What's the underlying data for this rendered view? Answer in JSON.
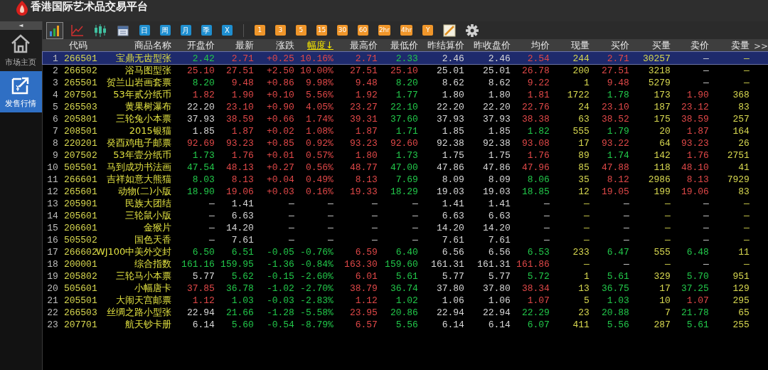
{
  "window": {
    "title": "香港国际艺术品交易平台"
  },
  "sidebar": {
    "collapse": "◄",
    "items": [
      {
        "label": "市场主页",
        "kind": "home",
        "selected": false
      },
      {
        "label": "发售行情",
        "kind": "trade",
        "selected": true
      }
    ]
  },
  "toolbar": {
    "chart_types": [
      {
        "kind": "bars",
        "selected": true
      },
      {
        "kind": "line",
        "selected": false
      },
      {
        "kind": "candles",
        "selected": false
      },
      {
        "kind": "calendar",
        "selected": false
      }
    ],
    "day_periods": [
      "日",
      "周",
      "月",
      "季",
      "X"
    ],
    "minute_periods": [
      "1",
      "3",
      "5",
      "15",
      "30",
      "60",
      "2hr",
      "4hr",
      "Y"
    ],
    "tools": [
      {
        "kind": "ruler"
      },
      {
        "kind": "gear"
      }
    ]
  },
  "table": {
    "columns": [
      {
        "label": "代码",
        "sorted": false
      },
      {
        "label": "商品名称",
        "sorted": false
      },
      {
        "label": "开盘价",
        "sorted": false
      },
      {
        "label": "最新",
        "sorted": false
      },
      {
        "label": "涨跌",
        "sorted": false
      },
      {
        "label": "幅度↓",
        "sorted": true
      },
      {
        "label": "最高价",
        "sorted": false
      },
      {
        "label": "最低价",
        "sorted": false
      },
      {
        "label": "昨结算价",
        "sorted": false
      },
      {
        "label": "昨收盘价",
        "sorted": false
      },
      {
        "label": "均价",
        "sorted": false
      },
      {
        "label": "现量",
        "sorted": false
      },
      {
        "label": "买价",
        "sorted": false
      },
      {
        "label": "买量",
        "sorted": false
      },
      {
        "label": "卖价",
        "sorted": false
      },
      {
        "label": "卖量",
        "sorted": false
      }
    ],
    "more": ">>",
    "rows": [
      {
        "no": "1",
        "selected": true,
        "cells": [
          {
            "text": "266501"
          },
          {
            "text": "宝鼎无齿型张"
          },
          {
            "text": "2.42",
            "color": "#22c84a"
          },
          {
            "text": "2.71",
            "color": "#e04848"
          },
          {
            "text": "+0.25",
            "color": "#e04848"
          },
          {
            "text": "10.16%",
            "color": "#e04848"
          },
          {
            "text": "2.71",
            "color": "#e04848"
          },
          {
            "text": "2.33",
            "color": "#22c84a"
          },
          {
            "text": "2.46",
            "color": "#d8d8d8"
          },
          {
            "text": "2.46",
            "color": "#d8d8d8"
          },
          {
            "text": "2.54",
            "color": "#e04848"
          },
          {
            "text": "244",
            "color": "#d8d850"
          },
          {
            "text": "2.71",
            "color": "#e04848"
          },
          {
            "text": "30257",
            "color": "#d8d850"
          },
          {
            "text": "—"
          },
          {
            "text": "—"
          }
        ]
      },
      {
        "no": "2",
        "selected": false,
        "cells": [
          {
            "text": "266502"
          },
          {
            "text": "浴马图型张"
          },
          {
            "text": "25.10",
            "color": "#e04848"
          },
          {
            "text": "27.51",
            "color": "#e04848"
          },
          {
            "text": "+2.50",
            "color": "#e04848"
          },
          {
            "text": "10.00%",
            "color": "#e04848"
          },
          {
            "text": "27.51",
            "color": "#e04848"
          },
          {
            "text": "25.10",
            "color": "#e04848"
          },
          {
            "text": "25.01",
            "color": "#d8d8d8"
          },
          {
            "text": "25.01",
            "color": "#d8d8d8"
          },
          {
            "text": "26.78",
            "color": "#e04848"
          },
          {
            "text": "200",
            "color": "#d8d850"
          },
          {
            "text": "27.51",
            "color": "#e04848"
          },
          {
            "text": "3218",
            "color": "#d8d850"
          },
          {
            "text": "—"
          },
          {
            "text": "—"
          }
        ]
      },
      {
        "no": "3",
        "selected": false,
        "cells": [
          {
            "text": "265501"
          },
          {
            "text": "贺兰山岩画套票"
          },
          {
            "text": "8.20",
            "color": "#22c84a"
          },
          {
            "text": "9.48",
            "color": "#e04848"
          },
          {
            "text": "+0.86",
            "color": "#e04848"
          },
          {
            "text": "9.98%",
            "color": "#e04848"
          },
          {
            "text": "9.48",
            "color": "#e04848"
          },
          {
            "text": "8.20",
            "color": "#22c84a"
          },
          {
            "text": "8.62",
            "color": "#d8d8d8"
          },
          {
            "text": "8.62",
            "color": "#d8d8d8"
          },
          {
            "text": "9.22",
            "color": "#e04848"
          },
          {
            "text": "1",
            "color": "#d8d850"
          },
          {
            "text": "9.48",
            "color": "#e04848"
          },
          {
            "text": "5279",
            "color": "#d8d850"
          },
          {
            "text": "—"
          },
          {
            "text": "—"
          }
        ]
      },
      {
        "no": "4",
        "selected": false,
        "cells": [
          {
            "text": "207501"
          },
          {
            "text": "53年贰分纸币"
          },
          {
            "text": "1.82",
            "color": "#e04848"
          },
          {
            "text": "1.90",
            "color": "#e04848"
          },
          {
            "text": "+0.10",
            "color": "#e04848"
          },
          {
            "text": "5.56%",
            "color": "#e04848"
          },
          {
            "text": "1.92",
            "color": "#e04848"
          },
          {
            "text": "1.77",
            "color": "#22c84a"
          },
          {
            "text": "1.80",
            "color": "#d8d8d8"
          },
          {
            "text": "1.80",
            "color": "#d8d8d8"
          },
          {
            "text": "1.81",
            "color": "#e04848"
          },
          {
            "text": "1722",
            "color": "#d8d850"
          },
          {
            "text": "1.78",
            "color": "#22c84a"
          },
          {
            "text": "173",
            "color": "#d8d850"
          },
          {
            "text": "1.90",
            "color": "#e04848"
          },
          {
            "text": "368",
            "color": "#d8d850"
          }
        ]
      },
      {
        "no": "5",
        "selected": false,
        "cells": [
          {
            "text": "265503"
          },
          {
            "text": "黄果树瀑布"
          },
          {
            "text": "22.20",
            "color": "#d8d8d8"
          },
          {
            "text": "23.10",
            "color": "#e04848"
          },
          {
            "text": "+0.90",
            "color": "#e04848"
          },
          {
            "text": "4.05%",
            "color": "#e04848"
          },
          {
            "text": "23.27",
            "color": "#e04848"
          },
          {
            "text": "22.10",
            "color": "#22c84a"
          },
          {
            "text": "22.20",
            "color": "#d8d8d8"
          },
          {
            "text": "22.20",
            "color": "#d8d8d8"
          },
          {
            "text": "22.76",
            "color": "#e04848"
          },
          {
            "text": "24",
            "color": "#d8d850"
          },
          {
            "text": "23.10",
            "color": "#e04848"
          },
          {
            "text": "187",
            "color": "#d8d850"
          },
          {
            "text": "23.12",
            "color": "#e04848"
          },
          {
            "text": "83",
            "color": "#d8d850"
          }
        ]
      },
      {
        "no": "6",
        "selected": false,
        "cells": [
          {
            "text": "205801"
          },
          {
            "text": "三轮兔小本票"
          },
          {
            "text": "37.93",
            "color": "#d8d8d8"
          },
          {
            "text": "38.59",
            "color": "#e04848"
          },
          {
            "text": "+0.66",
            "color": "#e04848"
          },
          {
            "text": "1.74%",
            "color": "#e04848"
          },
          {
            "text": "39.31",
            "color": "#e04848"
          },
          {
            "text": "37.60",
            "color": "#22c84a"
          },
          {
            "text": "37.93",
            "color": "#d8d8d8"
          },
          {
            "text": "37.93",
            "color": "#d8d8d8"
          },
          {
            "text": "38.38",
            "color": "#e04848"
          },
          {
            "text": "63",
            "color": "#d8d850"
          },
          {
            "text": "38.52",
            "color": "#e04848"
          },
          {
            "text": "175",
            "color": "#d8d850"
          },
          {
            "text": "38.59",
            "color": "#e04848"
          },
          {
            "text": "257",
            "color": "#d8d850"
          }
        ]
      },
      {
        "no": "7",
        "selected": false,
        "cells": [
          {
            "text": "208501"
          },
          {
            "text": "2015银猫"
          },
          {
            "text": "1.85",
            "color": "#d8d8d8"
          },
          {
            "text": "1.87",
            "color": "#e04848"
          },
          {
            "text": "+0.02",
            "color": "#e04848"
          },
          {
            "text": "1.08%",
            "color": "#e04848"
          },
          {
            "text": "1.87",
            "color": "#e04848"
          },
          {
            "text": "1.71",
            "color": "#22c84a"
          },
          {
            "text": "1.85",
            "color": "#d8d8d8"
          },
          {
            "text": "1.85",
            "color": "#d8d8d8"
          },
          {
            "text": "1.82",
            "color": "#22c84a"
          },
          {
            "text": "555",
            "color": "#d8d850"
          },
          {
            "text": "1.79",
            "color": "#22c84a"
          },
          {
            "text": "20",
            "color": "#d8d850"
          },
          {
            "text": "1.87",
            "color": "#e04848"
          },
          {
            "text": "164",
            "color": "#d8d850"
          }
        ]
      },
      {
        "no": "8",
        "selected": false,
        "cells": [
          {
            "text": "220201"
          },
          {
            "text": "癸酉鸡电子邮票"
          },
          {
            "text": "92.69",
            "color": "#e04848"
          },
          {
            "text": "93.23",
            "color": "#e04848"
          },
          {
            "text": "+0.85",
            "color": "#e04848"
          },
          {
            "text": "0.92%",
            "color": "#e04848"
          },
          {
            "text": "93.23",
            "color": "#e04848"
          },
          {
            "text": "92.60",
            "color": "#e04848"
          },
          {
            "text": "92.38",
            "color": "#d8d8d8"
          },
          {
            "text": "92.38",
            "color": "#d8d8d8"
          },
          {
            "text": "93.08",
            "color": "#e04848"
          },
          {
            "text": "17",
            "color": "#d8d850"
          },
          {
            "text": "93.22",
            "color": "#e04848"
          },
          {
            "text": "64",
            "color": "#d8d850"
          },
          {
            "text": "93.23",
            "color": "#e04848"
          },
          {
            "text": "26",
            "color": "#d8d850"
          }
        ]
      },
      {
        "no": "9",
        "selected": false,
        "cells": [
          {
            "text": "207502"
          },
          {
            "text": "53年壹分纸币"
          },
          {
            "text": "1.73",
            "color": "#22c84a"
          },
          {
            "text": "1.76",
            "color": "#e04848"
          },
          {
            "text": "+0.01",
            "color": "#e04848"
          },
          {
            "text": "0.57%",
            "color": "#e04848"
          },
          {
            "text": "1.80",
            "color": "#e04848"
          },
          {
            "text": "1.73",
            "color": "#22c84a"
          },
          {
            "text": "1.75",
            "color": "#d8d8d8"
          },
          {
            "text": "1.75",
            "color": "#d8d8d8"
          },
          {
            "text": "1.76",
            "color": "#e04848"
          },
          {
            "text": "89",
            "color": "#d8d850"
          },
          {
            "text": "1.74",
            "color": "#22c84a"
          },
          {
            "text": "142",
            "color": "#d8d850"
          },
          {
            "text": "1.76",
            "color": "#e04848"
          },
          {
            "text": "2751",
            "color": "#d8d850"
          }
        ]
      },
      {
        "no": "10",
        "selected": false,
        "cells": [
          {
            "text": "505501"
          },
          {
            "text": "马到成功书法画"
          },
          {
            "text": "47.54",
            "color": "#22c84a"
          },
          {
            "text": "48.13",
            "color": "#e04848"
          },
          {
            "text": "+0.27",
            "color": "#e04848"
          },
          {
            "text": "0.56%",
            "color": "#e04848"
          },
          {
            "text": "48.77",
            "color": "#e04848"
          },
          {
            "text": "47.00",
            "color": "#22c84a"
          },
          {
            "text": "47.86",
            "color": "#d8d8d8"
          },
          {
            "text": "47.86",
            "color": "#d8d8d8"
          },
          {
            "text": "47.96",
            "color": "#e04848"
          },
          {
            "text": "85",
            "color": "#d8d850"
          },
          {
            "text": "47.88",
            "color": "#e04848"
          },
          {
            "text": "118",
            "color": "#d8d850"
          },
          {
            "text": "48.10",
            "color": "#e04848"
          },
          {
            "text": "41",
            "color": "#d8d850"
          }
        ]
      },
      {
        "no": "11",
        "selected": false,
        "cells": [
          {
            "text": "266601"
          },
          {
            "text": "吉祥如意大熊猫"
          },
          {
            "text": "8.03",
            "color": "#22c84a"
          },
          {
            "text": "8.13",
            "color": "#e04848"
          },
          {
            "text": "+0.04",
            "color": "#e04848"
          },
          {
            "text": "0.49%",
            "color": "#e04848"
          },
          {
            "text": "8.13",
            "color": "#e04848"
          },
          {
            "text": "7.69",
            "color": "#22c84a"
          },
          {
            "text": "8.09",
            "color": "#d8d8d8"
          },
          {
            "text": "8.09",
            "color": "#d8d8d8"
          },
          {
            "text": "8.06",
            "color": "#22c84a"
          },
          {
            "text": "35",
            "color": "#d8d850"
          },
          {
            "text": "8.12",
            "color": "#e04848"
          },
          {
            "text": "2986",
            "color": "#d8d850"
          },
          {
            "text": "8.13",
            "color": "#e04848"
          },
          {
            "text": "7929",
            "color": "#d8d850"
          }
        ]
      },
      {
        "no": "12",
        "selected": false,
        "cells": [
          {
            "text": "265601"
          },
          {
            "text": "动物(二)小版"
          },
          {
            "text": "18.90",
            "color": "#22c84a"
          },
          {
            "text": "19.06",
            "color": "#e04848"
          },
          {
            "text": "+0.03",
            "color": "#e04848"
          },
          {
            "text": "0.16%",
            "color": "#e04848"
          },
          {
            "text": "19.33",
            "color": "#e04848"
          },
          {
            "text": "18.29",
            "color": "#22c84a"
          },
          {
            "text": "19.03",
            "color": "#d8d8d8"
          },
          {
            "text": "19.03",
            "color": "#d8d8d8"
          },
          {
            "text": "18.85",
            "color": "#22c84a"
          },
          {
            "text": "12",
            "color": "#d8d850"
          },
          {
            "text": "19.05",
            "color": "#e04848"
          },
          {
            "text": "199",
            "color": "#d8d850"
          },
          {
            "text": "19.06",
            "color": "#e04848"
          },
          {
            "text": "83",
            "color": "#d8d850"
          }
        ]
      },
      {
        "no": "13",
        "selected": false,
        "cells": [
          {
            "text": "205901"
          },
          {
            "text": "民族大团结"
          },
          {
            "text": "—"
          },
          {
            "text": "1.41",
            "color": "#d8d8d8"
          },
          {
            "text": "—"
          },
          {
            "text": "—"
          },
          {
            "text": "—"
          },
          {
            "text": "—"
          },
          {
            "text": "1.41",
            "color": "#d8d8d8"
          },
          {
            "text": "1.41",
            "color": "#d8d8d8"
          },
          {
            "text": "—"
          },
          {
            "text": "—"
          },
          {
            "text": "—"
          },
          {
            "text": "—"
          },
          {
            "text": "—"
          },
          {
            "text": "—"
          }
        ]
      },
      {
        "no": "14",
        "selected": false,
        "cells": [
          {
            "text": "205601"
          },
          {
            "text": "三轮鼠小版"
          },
          {
            "text": "—"
          },
          {
            "text": "6.63",
            "color": "#d8d8d8"
          },
          {
            "text": "—"
          },
          {
            "text": "—"
          },
          {
            "text": "—"
          },
          {
            "text": "—"
          },
          {
            "text": "6.63",
            "color": "#d8d8d8"
          },
          {
            "text": "6.63",
            "color": "#d8d8d8"
          },
          {
            "text": "—"
          },
          {
            "text": "—"
          },
          {
            "text": "—"
          },
          {
            "text": "—"
          },
          {
            "text": "—"
          },
          {
            "text": "—"
          }
        ]
      },
      {
        "no": "15",
        "selected": false,
        "cells": [
          {
            "text": "206601"
          },
          {
            "text": "金猴片"
          },
          {
            "text": "—"
          },
          {
            "text": "14.20",
            "color": "#d8d8d8"
          },
          {
            "text": "—"
          },
          {
            "text": "—"
          },
          {
            "text": "—"
          },
          {
            "text": "—"
          },
          {
            "text": "14.20",
            "color": "#d8d8d8"
          },
          {
            "text": "14.20",
            "color": "#d8d8d8"
          },
          {
            "text": "—"
          },
          {
            "text": "—"
          },
          {
            "text": "—"
          },
          {
            "text": "—"
          },
          {
            "text": "—"
          },
          {
            "text": "—"
          }
        ]
      },
      {
        "no": "16",
        "selected": false,
        "cells": [
          {
            "text": "505502"
          },
          {
            "text": "国色天香"
          },
          {
            "text": "—"
          },
          {
            "text": "7.61",
            "color": "#d8d8d8"
          },
          {
            "text": "—"
          },
          {
            "text": "—"
          },
          {
            "text": "—"
          },
          {
            "text": "—"
          },
          {
            "text": "7.61",
            "color": "#d8d8d8"
          },
          {
            "text": "7.61",
            "color": "#d8d8d8"
          },
          {
            "text": "—"
          },
          {
            "text": "—"
          },
          {
            "text": "—"
          },
          {
            "text": "—"
          },
          {
            "text": "—"
          },
          {
            "text": "—"
          }
        ]
      },
      {
        "no": "17",
        "selected": false,
        "cells": [
          {
            "text": "266602"
          },
          {
            "text": "WJ100中美外交封"
          },
          {
            "text": "6.50",
            "color": "#22c84a"
          },
          {
            "text": "6.51",
            "color": "#22c84a"
          },
          {
            "text": "-0.05",
            "color": "#22c84a"
          },
          {
            "text": "-0.76%",
            "color": "#22c84a"
          },
          {
            "text": "6.59",
            "color": "#e04848"
          },
          {
            "text": "6.40",
            "color": "#22c84a"
          },
          {
            "text": "6.56",
            "color": "#d8d8d8"
          },
          {
            "text": "6.56",
            "color": "#d8d8d8"
          },
          {
            "text": "6.53",
            "color": "#22c84a"
          },
          {
            "text": "233",
            "color": "#d8d850"
          },
          {
            "text": "6.47",
            "color": "#22c84a"
          },
          {
            "text": "555",
            "color": "#d8d850"
          },
          {
            "text": "6.48",
            "color": "#22c84a"
          },
          {
            "text": "11",
            "color": "#d8d850"
          }
        ]
      },
      {
        "no": "18",
        "selected": false,
        "cells": [
          {
            "text": "200001"
          },
          {
            "text": "综合指数"
          },
          {
            "text": "161.16",
            "color": "#22c84a"
          },
          {
            "text": "159.95",
            "color": "#22c84a"
          },
          {
            "text": "-1.36",
            "color": "#22c84a"
          },
          {
            "text": "-0.84%",
            "color": "#22c84a"
          },
          {
            "text": "163.30",
            "color": "#e04848"
          },
          {
            "text": "159.60",
            "color": "#22c84a"
          },
          {
            "text": "161.31",
            "color": "#d8d8d8"
          },
          {
            "text": "161.31",
            "color": "#d8d8d8"
          },
          {
            "text": "161.86",
            "color": "#e04848"
          },
          {
            "text": "—"
          },
          {
            "text": "—"
          },
          {
            "text": "—"
          },
          {
            "text": "—"
          },
          {
            "text": "—"
          }
        ]
      },
      {
        "no": "19",
        "selected": false,
        "cells": [
          {
            "text": "205802"
          },
          {
            "text": "三轮马小本票"
          },
          {
            "text": "5.77",
            "color": "#d8d8d8"
          },
          {
            "text": "5.62",
            "color": "#22c84a"
          },
          {
            "text": "-0.15",
            "color": "#22c84a"
          },
          {
            "text": "-2.60%",
            "color": "#22c84a"
          },
          {
            "text": "6.01",
            "color": "#e04848"
          },
          {
            "text": "5.61",
            "color": "#22c84a"
          },
          {
            "text": "5.77",
            "color": "#d8d8d8"
          },
          {
            "text": "5.77",
            "color": "#d8d8d8"
          },
          {
            "text": "5.72",
            "color": "#22c84a"
          },
          {
            "text": "1",
            "color": "#d8d850"
          },
          {
            "text": "5.61",
            "color": "#22c84a"
          },
          {
            "text": "329",
            "color": "#d8d850"
          },
          {
            "text": "5.70",
            "color": "#22c84a"
          },
          {
            "text": "951",
            "color": "#d8d850"
          }
        ]
      },
      {
        "no": "20",
        "selected": false,
        "cells": [
          {
            "text": "505601"
          },
          {
            "text": "小幅唐卡"
          },
          {
            "text": "37.85",
            "color": "#e04848"
          },
          {
            "text": "36.78",
            "color": "#22c84a"
          },
          {
            "text": "-1.02",
            "color": "#22c84a"
          },
          {
            "text": "-2.70%",
            "color": "#22c84a"
          },
          {
            "text": "38.79",
            "color": "#e04848"
          },
          {
            "text": "36.74",
            "color": "#22c84a"
          },
          {
            "text": "37.80",
            "color": "#d8d8d8"
          },
          {
            "text": "37.80",
            "color": "#d8d8d8"
          },
          {
            "text": "38.34",
            "color": "#e04848"
          },
          {
            "text": "13",
            "color": "#d8d850"
          },
          {
            "text": "36.75",
            "color": "#22c84a"
          },
          {
            "text": "17",
            "color": "#d8d850"
          },
          {
            "text": "37.25",
            "color": "#22c84a"
          },
          {
            "text": "129",
            "color": "#d8d850"
          }
        ]
      },
      {
        "no": "21",
        "selected": false,
        "cells": [
          {
            "text": "205501"
          },
          {
            "text": "大闹天宫邮票"
          },
          {
            "text": "1.12",
            "color": "#e04848"
          },
          {
            "text": "1.03",
            "color": "#22c84a"
          },
          {
            "text": "-0.03",
            "color": "#22c84a"
          },
          {
            "text": "-2.83%",
            "color": "#22c84a"
          },
          {
            "text": "1.12",
            "color": "#e04848"
          },
          {
            "text": "1.02",
            "color": "#22c84a"
          },
          {
            "text": "1.06",
            "color": "#d8d8d8"
          },
          {
            "text": "1.06",
            "color": "#d8d8d8"
          },
          {
            "text": "1.07",
            "color": "#e04848"
          },
          {
            "text": "5",
            "color": "#d8d850"
          },
          {
            "text": "1.03",
            "color": "#22c84a"
          },
          {
            "text": "10",
            "color": "#d8d850"
          },
          {
            "text": "1.07",
            "color": "#e04848"
          },
          {
            "text": "295",
            "color": "#d8d850"
          }
        ]
      },
      {
        "no": "22",
        "selected": false,
        "cells": [
          {
            "text": "266503"
          },
          {
            "text": "丝绸之路小型张"
          },
          {
            "text": "22.94",
            "color": "#d8d8d8"
          },
          {
            "text": "21.66",
            "color": "#22c84a"
          },
          {
            "text": "-1.28",
            "color": "#22c84a"
          },
          {
            "text": "-5.58%",
            "color": "#22c84a"
          },
          {
            "text": "23.95",
            "color": "#e04848"
          },
          {
            "text": "20.86",
            "color": "#22c84a"
          },
          {
            "text": "22.94",
            "color": "#d8d8d8"
          },
          {
            "text": "22.94",
            "color": "#d8d8d8"
          },
          {
            "text": "22.29",
            "color": "#22c84a"
          },
          {
            "text": "23",
            "color": "#d8d850"
          },
          {
            "text": "20.88",
            "color": "#22c84a"
          },
          {
            "text": "7",
            "color": "#d8d850"
          },
          {
            "text": "21.78",
            "color": "#22c84a"
          },
          {
            "text": "65",
            "color": "#d8d850"
          }
        ]
      },
      {
        "no": "23",
        "selected": false,
        "cells": [
          {
            "text": "207701"
          },
          {
            "text": "航天钞卡册"
          },
          {
            "text": "6.14",
            "color": "#d8d8d8"
          },
          {
            "text": "5.60",
            "color": "#22c84a"
          },
          {
            "text": "-0.54",
            "color": "#22c84a"
          },
          {
            "text": "-8.79%",
            "color": "#22c84a"
          },
          {
            "text": "6.57",
            "color": "#e04848"
          },
          {
            "text": "5.56",
            "color": "#22c84a"
          },
          {
            "text": "6.14",
            "color": "#d8d8d8"
          },
          {
            "text": "6.14",
            "color": "#d8d8d8"
          },
          {
            "text": "6.07",
            "color": "#22c84a"
          },
          {
            "text": "411",
            "color": "#d8d850"
          },
          {
            "text": "5.56",
            "color": "#22c84a"
          },
          {
            "text": "287",
            "color": "#d8d850"
          },
          {
            "text": "5.61",
            "color": "#22c84a"
          },
          {
            "text": "255",
            "color": "#d8d850"
          }
        ]
      }
    ]
  }
}
